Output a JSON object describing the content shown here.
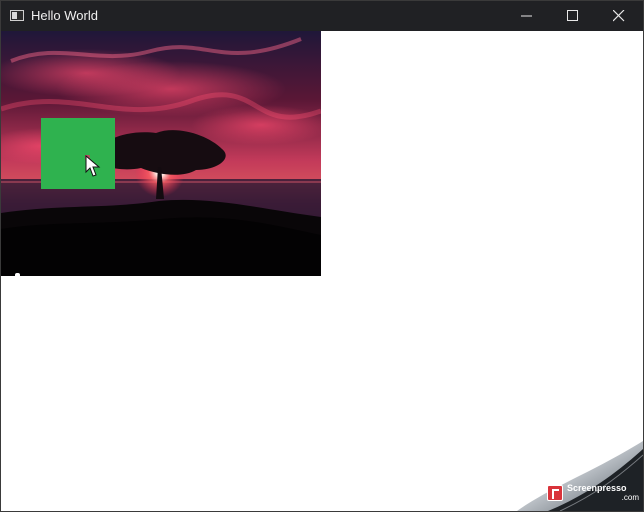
{
  "window": {
    "title": "Hello World",
    "controls": {
      "minimize_icon": "minimize-icon",
      "maximize_icon": "maximize-icon",
      "close_icon": "close-icon"
    }
  },
  "content": {
    "image": {
      "subject": "sunset-tree",
      "accent_color": "#2fb24f"
    }
  },
  "watermark": {
    "brand": "Screenpresso",
    "domain": ".com"
  }
}
